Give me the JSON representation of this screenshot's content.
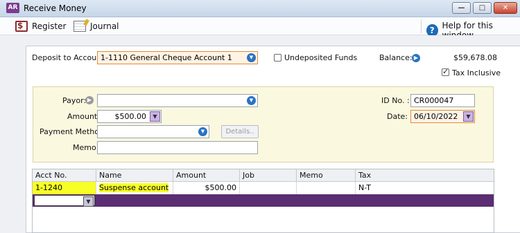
{
  "window": {
    "app_badge": "AR",
    "title": "Receive Money"
  },
  "toolbar": {
    "register_label": "Register",
    "journal_label": "Journal",
    "help_label": "Help for this window"
  },
  "header": {
    "deposit_label": "Deposit to Account:",
    "deposit_value": "1-1110 General Cheque Account 1",
    "undeposited_label": "Undeposited Funds",
    "undeposited_checked": false,
    "balance_label": "Balance:",
    "balance_value": "$59,678.08",
    "tax_inclusive_label": "Tax Inclusive",
    "tax_inclusive_checked": true
  },
  "form": {
    "payor_label": "Payor:",
    "payor_value": "",
    "amount_label": "Amount:",
    "amount_value": "$500.00",
    "payment_method_label": "Payment Method:",
    "payment_method_value": "",
    "details_label": "Details..",
    "memo_label": "Memo:",
    "memo_value": "",
    "id_label": "ID No. :",
    "id_value": "CR000047",
    "date_label": "Date:",
    "date_value": "06/10/2022"
  },
  "grid": {
    "columns": [
      "Acct No.",
      "Name",
      "Amount",
      "Job",
      "Memo",
      "Tax"
    ],
    "rows": [
      {
        "acct": "1-1240",
        "name": "Suspense account",
        "amount": "$500.00",
        "job": "",
        "memo": "",
        "tax": "N-T"
      }
    ]
  },
  "colors": {
    "highlight": "#f8ff27",
    "active_row": "#5b2d72",
    "accent_blue": "#2a73c3"
  }
}
